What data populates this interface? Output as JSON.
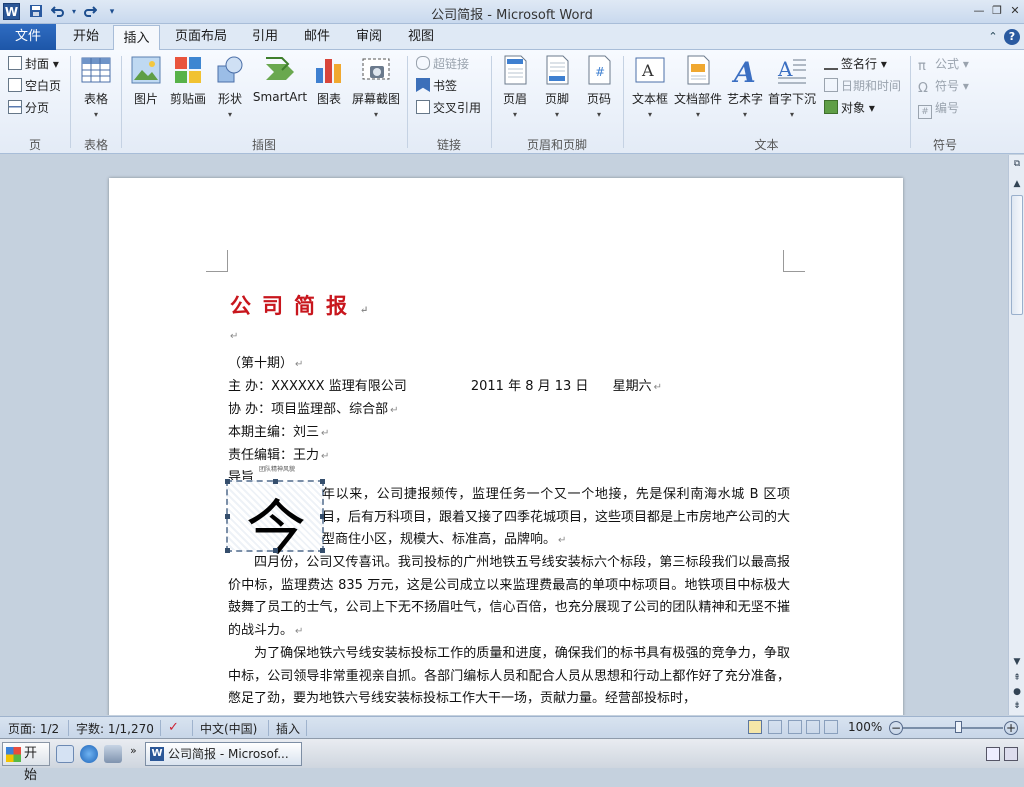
{
  "window": {
    "title": "公司简报  -  Microsoft Word",
    "app_letter": "W"
  },
  "tabs": {
    "file": "文件",
    "items": [
      "开始",
      "插入",
      "页面布局",
      "引用",
      "邮件",
      "审阅",
      "视图"
    ],
    "active": "插入"
  },
  "ribbon": {
    "pages_group": {
      "cover": "封面",
      "blank": "空白页",
      "break": "分页",
      "label": "页"
    },
    "table_group": {
      "table": "表格",
      "label": "表格"
    },
    "illustrations": {
      "picture": "图片",
      "clipart": "剪贴画",
      "shapes": "形状",
      "smartart": "SmartArt",
      "chart": "图表",
      "screenshot": "屏幕截图",
      "label": "插图"
    },
    "links": {
      "hyperlink": "超链接",
      "bookmark": "书签",
      "crossref": "交叉引用",
      "label": "链接"
    },
    "header_footer": {
      "header": "页眉",
      "footer": "页脚",
      "pagenum": "页码",
      "label": "页眉和页脚"
    },
    "text": {
      "textbox": "文本框",
      "quickparts": "文档部件",
      "wordart": "艺术字",
      "dropcap": "首字下沉",
      "signature": "签名行",
      "datetime": "日期和时间",
      "object": "对象",
      "label": "文本"
    },
    "symbols": {
      "equation": "公式",
      "symbol": "符号",
      "number": "编号",
      "label": "符号"
    }
  },
  "document": {
    "title": "公司简报",
    "issue": "（第十期）",
    "host_label": "主        办：",
    "host": "XXXXXX 监理有限公司",
    "date": "2011 年 8 月 13 日",
    "weekday": "星期六",
    "co_label": "协        办：",
    "co": "项目监理部、综合部",
    "chief_label": "本期主编：",
    "chief": "刘三",
    "editor_label": "责任编辑：",
    "editor": "王力",
    "lead_label": "导旨",
    "tiny_note": "团队精神风貌",
    "dropcap_char": "今",
    "para1": "年以来，公司捷报频传，监理任务一个又一个地接，先是保利南海水城 B 区项目，后有万科项目，跟着又接了四季花城项目，这些项目都是上市房地产公司的大型商住小区，规模大、标准高，品牌响。",
    "para2": "四月份，公司又传喜讯。我司投标的广州地铁五号线安装标六个标段，第三标段我们以最高报价中标，监理费达 835 万元，这是公司成立以来监理费最高的单项中标项目。地铁项目中标极大鼓舞了员工的士气，公司上下无不扬眉吐气，信心百倍，也充分展现了公司的团队精神和无坚不摧的战斗力。",
    "para3": "为了确保地铁六号线安装标投标工作的质量和进度，确保我们的标书具有极强的竞争力，争取中标，公司领导非常重视亲自抓。各部门编标人员和配合人员从思想和行动上都作好了充分准备，憋足了劲，要为地铁六号线安装标投标工作大干一场，贡献力量。经营部投标时，"
  },
  "status": {
    "page": "页面: 1/2",
    "words": "字数: 1/1,270",
    "language": "中文(中国)",
    "mode": "插入",
    "zoom": "100%",
    "zoom_fraction": 0.55
  },
  "taskbar": {
    "start": "开始",
    "task": "公司简报 - Microsof..."
  },
  "colors": {
    "title_red": "#c8161d",
    "file_tab_blue": "#2b64b5"
  }
}
